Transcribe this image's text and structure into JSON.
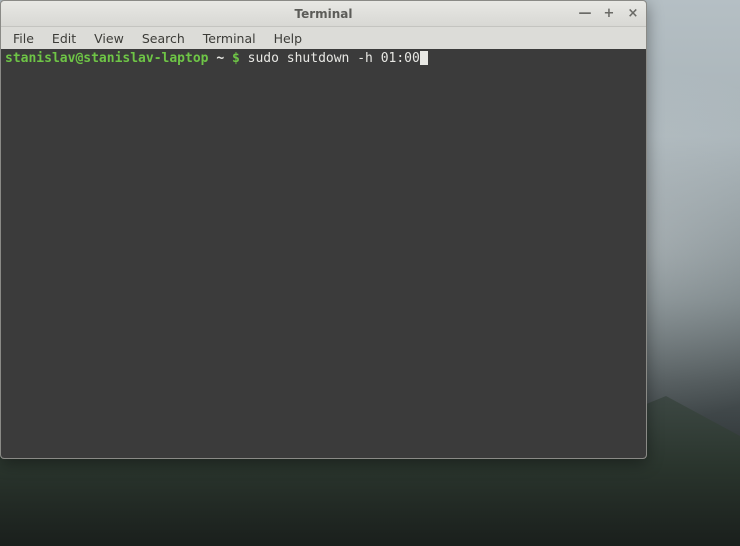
{
  "window": {
    "title": "Terminal",
    "controls": {
      "minimize": "—",
      "maximize": "+",
      "close": "×"
    }
  },
  "menubar": {
    "items": [
      {
        "label": "File"
      },
      {
        "label": "Edit"
      },
      {
        "label": "View"
      },
      {
        "label": "Search"
      },
      {
        "label": "Terminal"
      },
      {
        "label": "Help"
      }
    ]
  },
  "terminal": {
    "prompt": {
      "user_host": "stanislav@stanislav-laptop",
      "separator": " ~ ",
      "symbol": "$"
    },
    "command": " sudo shutdown -h 01:00"
  }
}
